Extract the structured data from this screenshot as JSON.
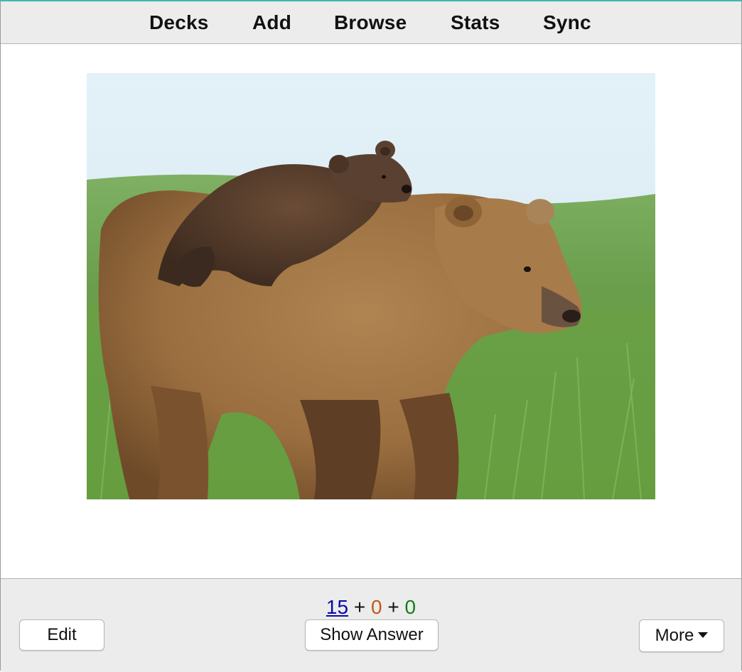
{
  "nav": {
    "decks": "Decks",
    "add": "Add",
    "browse": "Browse",
    "stats": "Stats",
    "sync": "Sync"
  },
  "card": {
    "image_alt": "Brown bear cub resting on mother bear's back in a grassy meadow"
  },
  "counts": {
    "new": "15",
    "plus1": "+",
    "learn": "0",
    "plus2": "+",
    "review": "0",
    "colors": {
      "new": "#0a0aa8",
      "learn": "#c35617",
      "review": "#138013"
    }
  },
  "buttons": {
    "edit": "Edit",
    "show_answer": "Show Answer",
    "more": "More"
  },
  "icons": {
    "more_caret": "caret-down-icon"
  },
  "colors": {
    "window_accent": "#3fb8b0",
    "toolbar_bg": "#ececec"
  }
}
